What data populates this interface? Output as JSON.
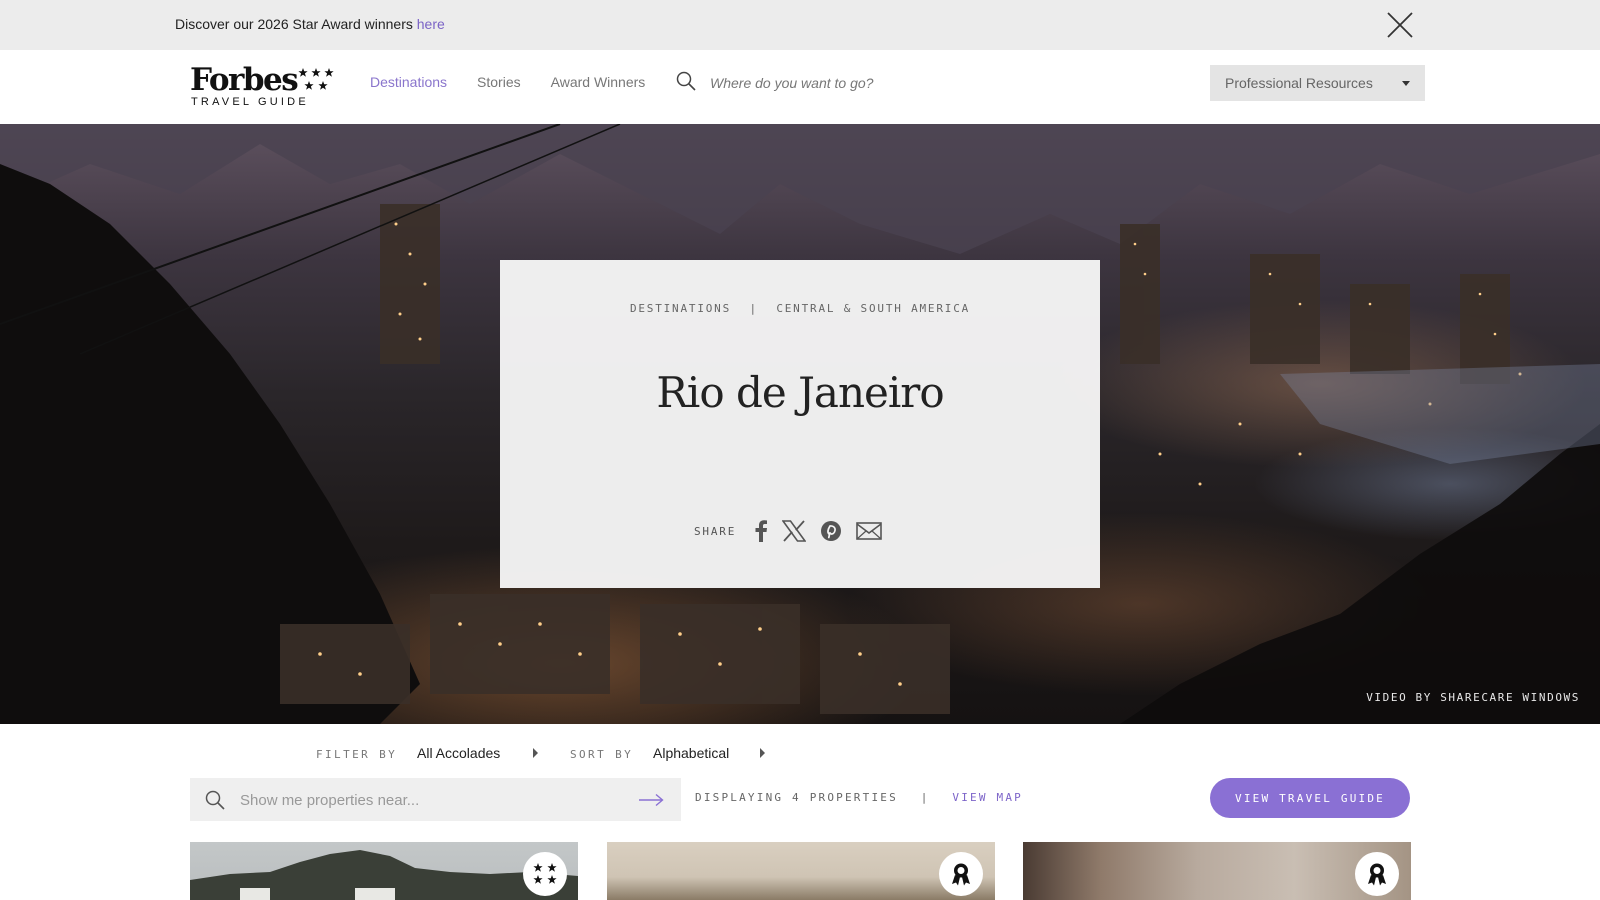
{
  "announcement": {
    "text": "Discover our 2026 Star Award winners",
    "link_text": "here"
  },
  "header": {
    "logo": {
      "word": "Forbes",
      "subtitle": "TRAVEL GUIDE"
    },
    "nav": [
      "Destinations",
      "Stories",
      "Award Winners"
    ],
    "active_nav": "Destinations",
    "search": {
      "placeholder": "Where do you want to go?"
    },
    "professional_resources": "Professional Resources"
  },
  "hero": {
    "breadcrumb": [
      "DESTINATIONS",
      "CENTRAL & SOUTH AMERICA"
    ],
    "breadcrumb_separator": "|",
    "title": "Rio de Janeiro",
    "share_label": "SHARE",
    "share_icons": [
      "facebook-icon",
      "x-icon",
      "pinterest-icon",
      "email-icon"
    ],
    "credit": "VIDEO BY SHARECARE WINDOWS"
  },
  "filters": {
    "filter_label": "FILTER BY",
    "filter_value": "All Accolades",
    "sort_label": "SORT BY",
    "sort_value": "Alphabetical"
  },
  "listing": {
    "search_placeholder": "Show me properties near...",
    "displaying": "DISPLAYING 4 PROPERTIES",
    "separator": "|",
    "view_map": "VIEW MAP",
    "view_guide": "VIEW TRAVEL GUIDE"
  },
  "cards": [
    {
      "badge": "stars-badge-icon"
    },
    {
      "badge": "award-ribbon-icon"
    },
    {
      "badge": "award-ribbon-icon"
    }
  ],
  "colors": {
    "accent": "#8a70d4",
    "link": "#7b63c6",
    "announcement_bg": "#ececec"
  }
}
